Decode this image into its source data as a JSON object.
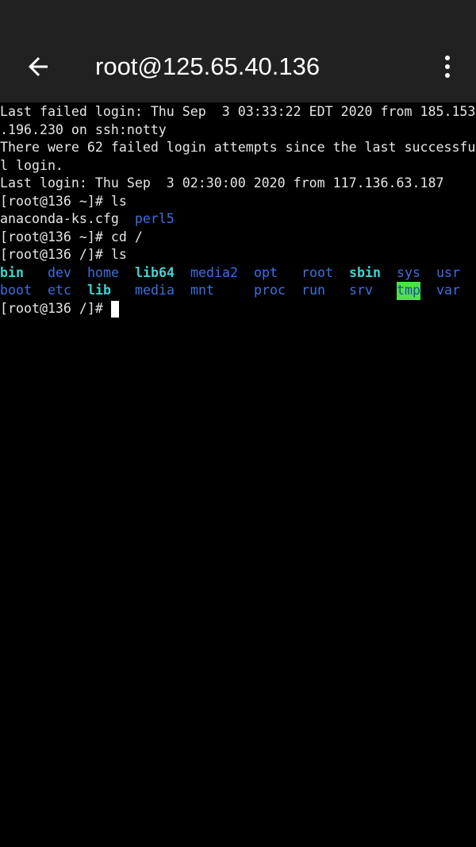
{
  "appbar": {
    "title": "root@125.65.40.136",
    "back_icon": "arrow-left-icon",
    "menu_icon": "more-vert-icon"
  },
  "terminal": {
    "lines": [
      "Last failed login: Thu Sep  3 03:33:22 EDT 2020 from 185.153",
      ".196.230 on ssh:notty",
      "There were 62 failed login attempts since the last successfu",
      "l login.",
      "Last login: Thu Sep  3 02:30:00 2020 from 117.136.63.187",
      "[root@136 ~]# ls"
    ],
    "home_ls": [
      {
        "text": "anaconda-ks.cfg",
        "type": "file"
      },
      {
        "text": "perl5",
        "type": "dir"
      }
    ],
    "cmd_cd": "[root@136 ~]# cd /",
    "cmd_ls": "[root@136 /]# ls",
    "root_ls_rows": [
      [
        {
          "text": "bin",
          "type": "link"
        },
        {
          "text": "dev",
          "type": "dir"
        },
        {
          "text": "home",
          "type": "dir"
        },
        {
          "text": "lib64",
          "type": "link"
        },
        {
          "text": "media2",
          "type": "dir"
        },
        {
          "text": "opt",
          "type": "dir"
        },
        {
          "text": "root",
          "type": "dir"
        },
        {
          "text": "sbin",
          "type": "link"
        },
        {
          "text": "sys",
          "type": "dir"
        },
        {
          "text": "usr",
          "type": "dir"
        }
      ],
      [
        {
          "text": "boot",
          "type": "dir"
        },
        {
          "text": "etc",
          "type": "dir"
        },
        {
          "text": "lib",
          "type": "link"
        },
        {
          "text": "media",
          "type": "dir"
        },
        {
          "text": "mnt",
          "type": "dir"
        },
        {
          "text": "proc",
          "type": "dir"
        },
        {
          "text": "run",
          "type": "dir"
        },
        {
          "text": "srv",
          "type": "dir"
        },
        {
          "text": "tmp",
          "type": "sticky"
        },
        {
          "text": "var",
          "type": "dir"
        }
      ]
    ],
    "prompt": "[root@136 /]# ",
    "colors": {
      "dir": "#3d6fe0",
      "link": "#3ed3d3",
      "sticky_bg": "#4fe04a",
      "background": "#000000",
      "appbar": "#212121"
    }
  }
}
